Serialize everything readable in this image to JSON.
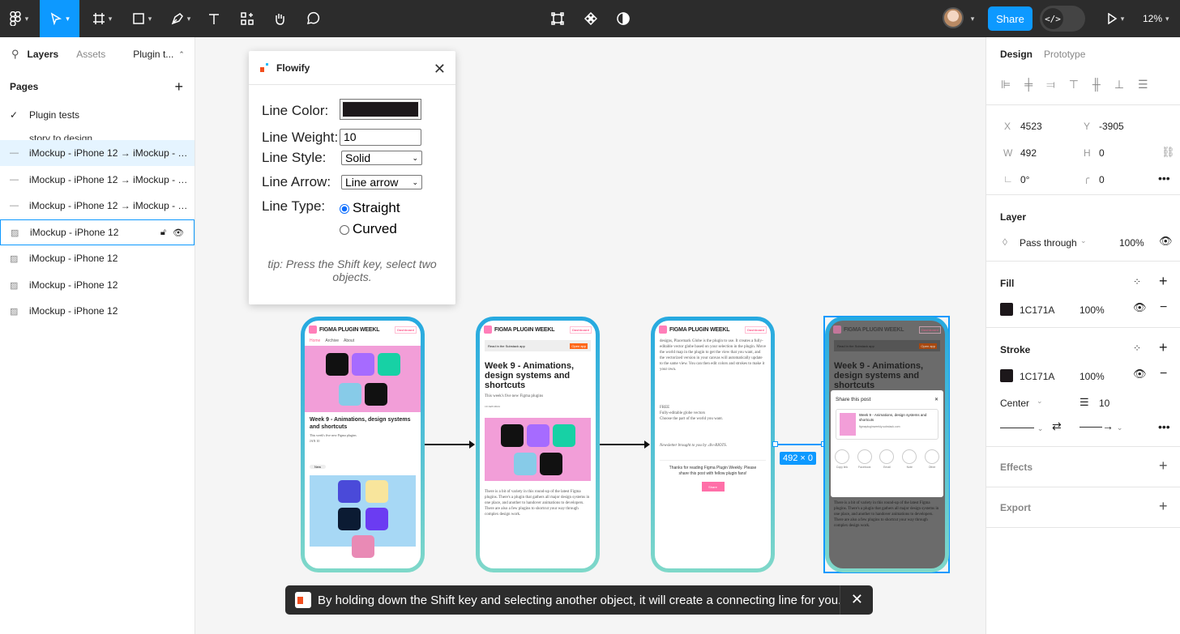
{
  "toolbar": {
    "zoom": "12%",
    "share_label": "Share",
    "dev_mode_label": "</>"
  },
  "left_panel": {
    "tabs": [
      "Layers",
      "Assets",
      "Plugin t..."
    ],
    "pages_title": "Pages",
    "current_page": "Plugin tests",
    "partial_page": "story to design",
    "layers": [
      "iMockup - iPhone 12 → iMockup - i...",
      "iMockup - iPhone 12 → iMockup - i...",
      "iMockup - iPhone 12 → iMockup - i...",
      "iMockup - iPhone 12",
      "iMockup - iPhone 12",
      "iMockup - iPhone 12",
      "iMockup - iPhone 12"
    ]
  },
  "plugin": {
    "title": "Flowify",
    "line_color_label": "Line Color:",
    "line_weight_label": "Line Weight:",
    "line_weight_value": "10",
    "line_style_label": "Line Style:",
    "line_style_value": "Solid",
    "line_arrow_label": "Line Arrow:",
    "line_arrow_value": "Line arrow",
    "line_type_label": "Line Type:",
    "line_type_options": [
      "Straight",
      "Curved"
    ],
    "line_type_selected": "Straight",
    "line_color": "#1c171a",
    "tip": "tip: Press the Shift key, select two objects."
  },
  "phones": {
    "brand": "FIGMA PLUGIN WEEKL",
    "dashboard": "Dashboard",
    "nav": [
      "Home",
      "Archive",
      "About"
    ],
    "article_title": "Week 9 - Animations, design systems and shortcuts",
    "subtitle": "This week's five new Figma plugins",
    "date": "JAN 10",
    "date_long": "10 JAN 2024",
    "new_badge": "New",
    "substack_text": "Read in the Substack app",
    "open_app": "Open app",
    "body_text": "There is a bit of variety in this round-up of the latest Figma plugins. There's a plugin that gathers all major design systems in one place, and another to handover animations to developers. There are also a few plugins to shortcut your way through complex design work.",
    "globe_text": "designs, Placemark Globe is the plugin to use. It creates a fully-editable vector globe based on your selection in the plugin. Move the world map in the plugin to get the view that you want, and the vectorized version in your canvas will automatically update to the same view. You can then edit colors and strokes to make it your own.",
    "bullets": [
      "FREE",
      "Fully-editable globe vectors",
      "Choose the part of the world you want."
    ],
    "newsletter": "Newsletter brought to you by .div-RIOTS.",
    "thanks": "Thanks for reading Figma Plugin Weekly. Please share this post with fellow plugin fans!",
    "share_btn": "Share",
    "share_post": "Share this post",
    "share_card_title": "Week 9 - Animations, design systems and shortcuts",
    "share_card_url": "figmapluginweekly.substack.com",
    "share_options": [
      "Copy link",
      "Facebook",
      "Email",
      "Note",
      "Other"
    ]
  },
  "dimension_badge": "492 × 0",
  "toast": {
    "message": "By holding down the Shift key and selecting another object, it will create a connecting line for you."
  },
  "help": "?",
  "right_panel": {
    "tabs": [
      "Design",
      "Prototype"
    ],
    "x_label": "X",
    "x": "4523",
    "y_label": "Y",
    "y": "-3905",
    "w_label": "W",
    "w": "492",
    "h_label": "H",
    "h": "0",
    "rotation": "0°",
    "radius": "0",
    "layer_title": "Layer",
    "blend": "Pass through",
    "layer_opacity": "100%",
    "fill_title": "Fill",
    "fill_hex": "1C171A",
    "fill_opacity": "100%",
    "stroke_title": "Stroke",
    "stroke_hex": "1C171A",
    "stroke_opacity": "100%",
    "stroke_align": "Center",
    "stroke_weight": "10",
    "effects_title": "Effects",
    "export_title": "Export",
    "swatch_color": "#1c171a"
  }
}
